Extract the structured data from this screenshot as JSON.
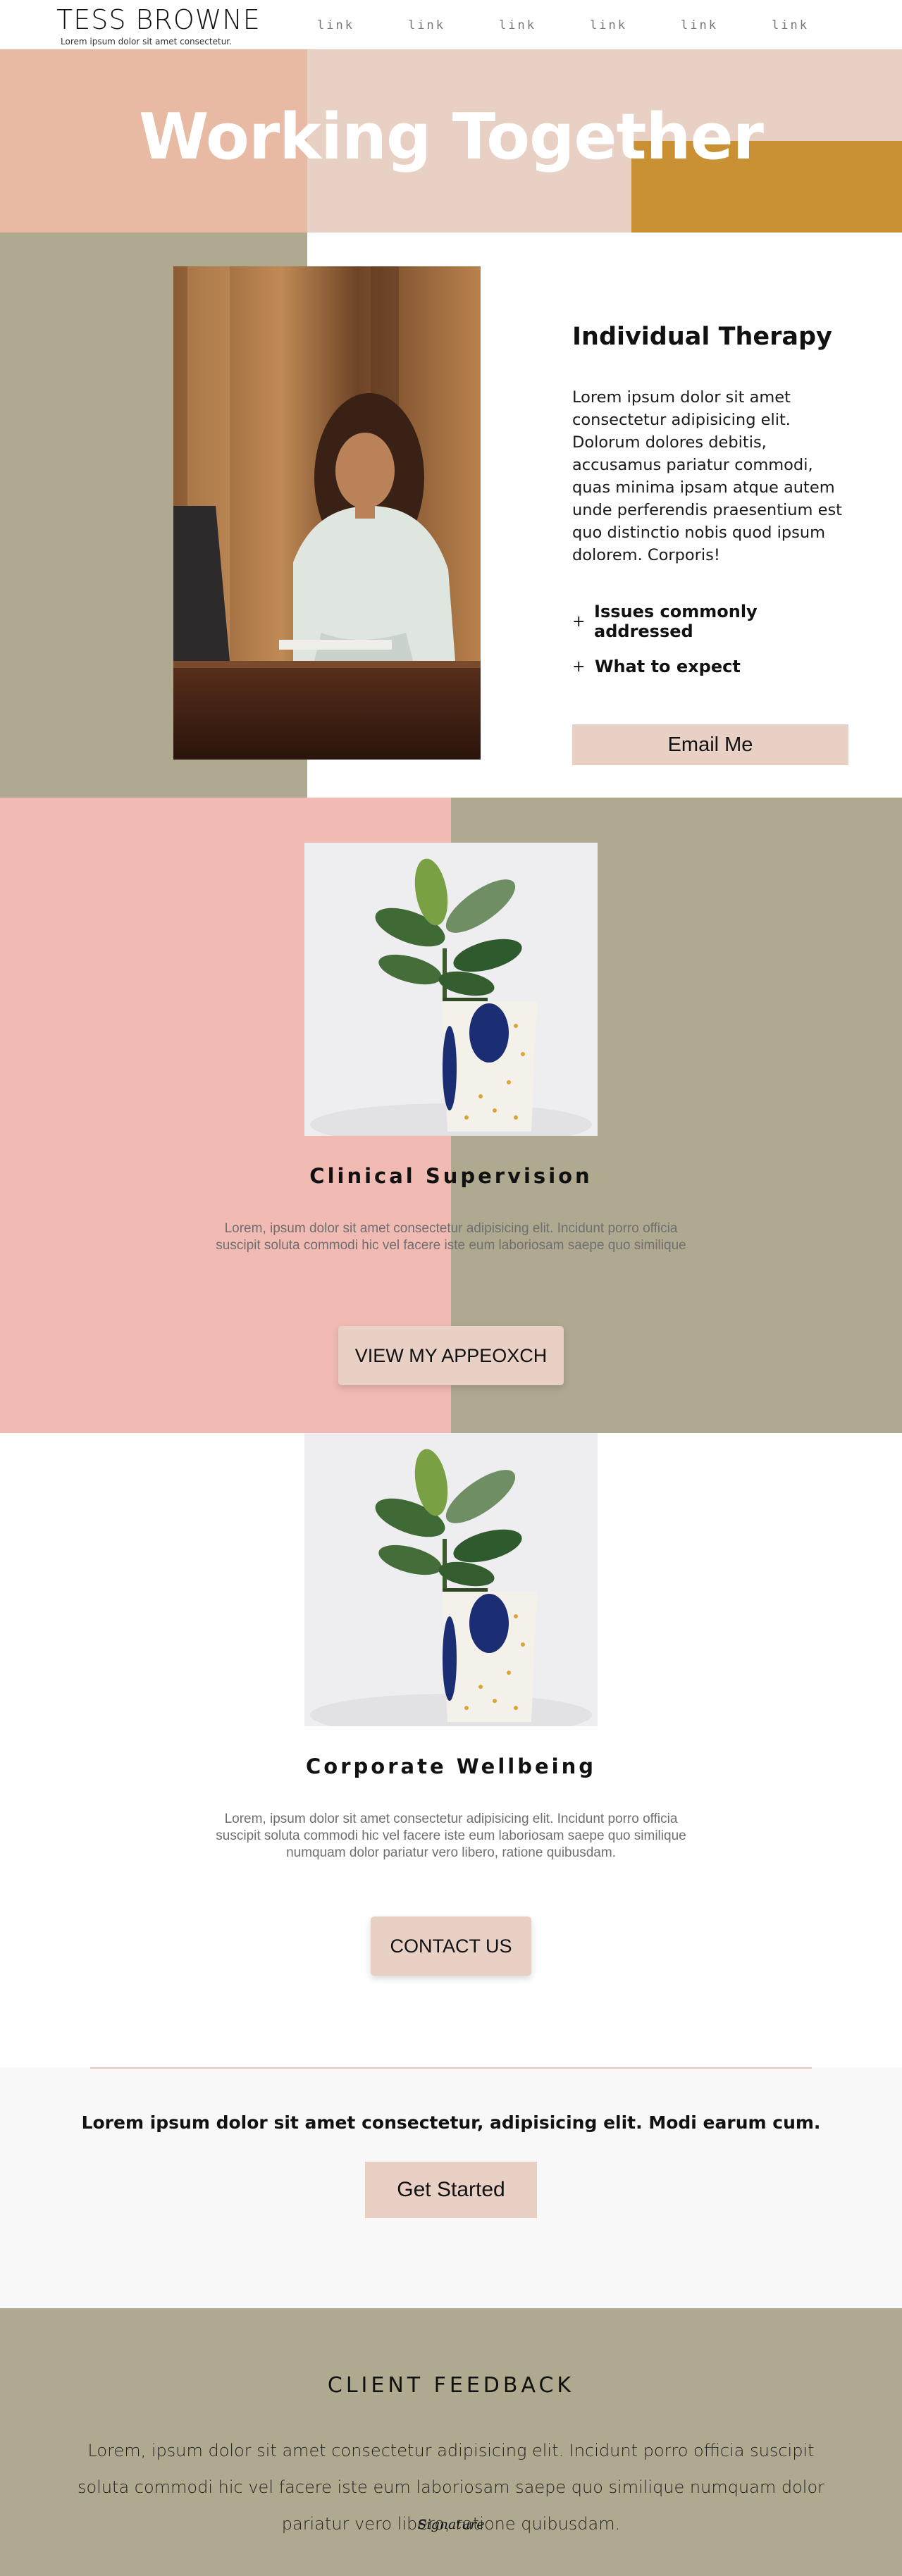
{
  "header": {
    "brand_name": "TESS BROWNE",
    "brand_tagline": "Lorem ipsum dolor sit amet consectetur.",
    "nav": [
      "link",
      "link",
      "link",
      "link",
      "link",
      "link"
    ]
  },
  "hero": {
    "title": "Working Together"
  },
  "therapy": {
    "title": "Individual Therapy",
    "body": "Lorem ipsum dolor sit amet consectetur adipisicing elit. Dolorum dolores debitis, accusamus pariatur commodi, quas minima ipsam atque autem unde perferendis praesentium est quo distinctio nobis quod ipsum dolorem. Corporis!",
    "faq": [
      {
        "icon": "+",
        "label": "Issues commonly addressed"
      },
      {
        "icon": "+",
        "label": "What to expect"
      }
    ],
    "button": "Email Me"
  },
  "clinical": {
    "title": "Clinical Supervision",
    "body": "Lorem, ipsum dolor sit amet consectetur adipisicing elit. Incidunt porro officia suscipit soluta commodi hic vel facere iste eum laboriosam saepe quo similique",
    "button": "VIEW MY APPEOXCH"
  },
  "corporate": {
    "title": "Corporate Wellbeing",
    "body": "Lorem, ipsum dolor sit amet consectetur adipisicing elit. Incidunt porro officia suscipit soluta commodi hic vel facere iste eum laboriosam saepe quo similique numquam dolor pariatur vero libero, ratione quibusdam.",
    "button": "CONTACT US"
  },
  "cta": {
    "text": "Lorem ipsum dolor sit amet consectetur, adipisicing elit. Modi earum cum.",
    "button": "Get Started"
  },
  "feedback": {
    "title": "CLIENT FEEDBACK",
    "body": "Lorem, ipsum dolor sit amet consectetur adipisicing elit. Incidunt porro officia suscipit soluta commodi hic vel facere iste eum laboriosam saepe quo similique numquam dolor pariatur vero libero, ratione quibusdam.",
    "signature": "Signature"
  },
  "colors": {
    "peach": "#e8baa3",
    "blush": "#e8d0c5",
    "gold": "#c99133",
    "sage": "#afa990",
    "pink": "#f1bab3"
  },
  "images": {
    "portrait": "woman-portrait-photo",
    "plant": "potted-plant-photo"
  }
}
